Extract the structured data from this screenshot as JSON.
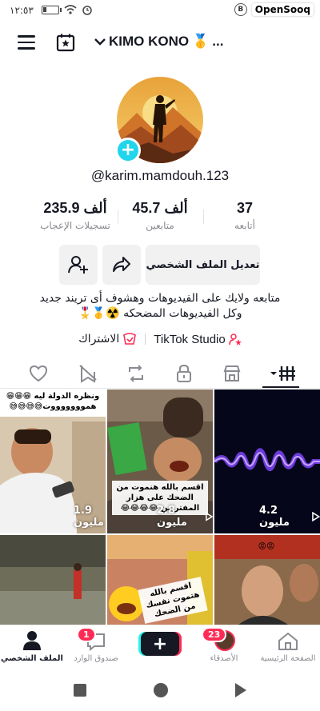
{
  "status_bar": {
    "time": "١٢:٥٣",
    "watermark": "OpenSooq",
    "b_badge": "B"
  },
  "header": {
    "account_name": "KIMO KONO",
    "account_emoji": "🥇",
    "more": "..."
  },
  "profile": {
    "handle": "@karim.mamdouh.123"
  },
  "stats": [
    {
      "value": "37",
      "label": "أتابعه"
    },
    {
      "value": "45.7 ألف",
      "label": "متابعين"
    },
    {
      "value": "235.9 ألف",
      "label": "تسجيلات الإعجاب"
    }
  ],
  "actions": {
    "edit_profile": "تعديل الملف الشخصي"
  },
  "bio": {
    "line1": "متابعه ولايك على الفيديوهات وهشوف أى تريند جديد",
    "line2": "وكل الفيديوهات المضحكه ☢️🥇🎖️"
  },
  "links": {
    "studio": "TikTok Studio",
    "subscribe": "الاشتراك"
  },
  "videos": [
    {
      "views": "1.9 مليون",
      "caption": "ونظره الدولة ليه 😁😁😁 هموووووووت😅😅😅😅"
    },
    {
      "views": "2.8 مليون",
      "caption": "اقسم بالله هنموت من الضحك على هزار المفتريين 😂😂😂😂"
    },
    {
      "views": "4.2 مليون",
      "caption": ""
    },
    {
      "views": "",
      "caption": ""
    },
    {
      "views": "",
      "caption": "اقسم بالله هتموت نفسك من الضحك"
    },
    {
      "views": "",
      "caption": "😡😡"
    }
  ],
  "bottom_nav": {
    "home": "الصفحة الرئيسية",
    "friends": "الأصدقاء",
    "inbox": "صندوق الوارد",
    "profile": "الملف الشخصي",
    "friends_badge": "23",
    "inbox_badge": "1"
  },
  "colors": {
    "accent": "#20d5ec",
    "brand_red": "#fe2c55",
    "text": "#161823",
    "muted": "#8a8b91"
  }
}
